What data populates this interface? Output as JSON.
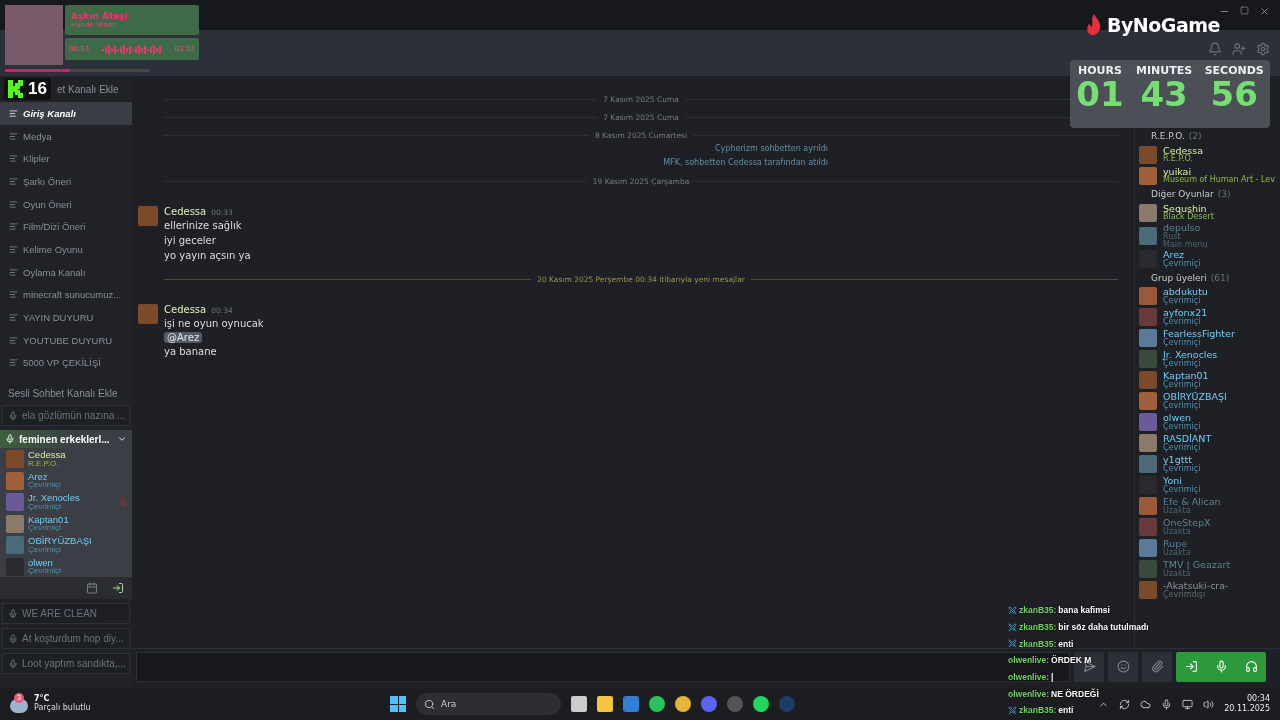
{
  "now_playing": {
    "title": "Aşkın Ateşi",
    "artist": "Hande Yener",
    "elapsed": "00:53",
    "total": "03:52",
    "level": 0.45
  },
  "kick_badge": {
    "count": "16"
  },
  "logo": {
    "text": "ByNoGame"
  },
  "timer": {
    "units": [
      {
        "label": "HOURS",
        "value": "01"
      },
      {
        "label": "MINUTES",
        "value": "43"
      },
      {
        "label": "SECONDS",
        "value": "56"
      }
    ]
  },
  "sidebar": {
    "add_text_channel": "et Kanalı Ekle",
    "text_channels": [
      {
        "name": "Giriş Kanalı",
        "selected": true
      },
      {
        "name": "Medya",
        "selected": false
      },
      {
        "name": "Klipler",
        "selected": false
      },
      {
        "name": "Şarkı Öneri",
        "selected": false
      },
      {
        "name": "Oyun Öneri",
        "selected": false
      },
      {
        "name": "Film/Dizi Öneri",
        "selected": false
      },
      {
        "name": "Kelime Oyunu",
        "selected": false
      },
      {
        "name": "Oylama Kanalı",
        "selected": false
      },
      {
        "name": "minecraft sunucumuz...",
        "selected": false
      },
      {
        "name": "YAYIN DUYURU",
        "selected": false
      },
      {
        "name": "YOUTUBE DUYURU",
        "selected": false
      },
      {
        "name": "5000 VP ÇEKİLİŞİ",
        "selected": false
      }
    ],
    "add_voice_channel": "Sesli Sohbet Kanalı Ekle",
    "voice_channels": [
      {
        "name": "ela gözlümün nazına ...",
        "expanded": false
      },
      {
        "name": "feminen erkeklerl...",
        "expanded": true,
        "members": [
          {
            "name": "Cedessa",
            "status": "R.E.P.O.",
            "kind": "ingame",
            "muted": false
          },
          {
            "name": "Arez",
            "status": "Çevrimiçi",
            "kind": "online",
            "muted": false
          },
          {
            "name": "Jr. Xenocles",
            "status": "Çevrimiçi",
            "kind": "online",
            "muted": true
          },
          {
            "name": "Kaptan01",
            "status": "Çevrimiçi",
            "kind": "online",
            "muted": false
          },
          {
            "name": "OBİRYÜZBAŞI",
            "status": "Çevrimiçi",
            "kind": "online",
            "muted": false
          },
          {
            "name": "olwen",
            "status": "Çevrimiçi",
            "kind": "online",
            "muted": false
          }
        ]
      },
      {
        "name": "WE ARE CLEAN",
        "expanded": false
      },
      {
        "name": "At koşturdum hop diy...",
        "expanded": false
      },
      {
        "name": "Loot yaptım sandıkta,...",
        "expanded": false
      }
    ]
  },
  "chat": {
    "entries": [
      {
        "kind": "date",
        "text": "7 Kasım 2025 Cuma"
      },
      {
        "kind": "date",
        "text": "7 Kasım 2025 Cuma"
      },
      {
        "kind": "date",
        "text": "8 Kasım 2025 Cumartesi"
      },
      {
        "kind": "system",
        "text": "Cypherizm sohbetten ayrıldı"
      },
      {
        "kind": "system",
        "text": "MFK, sohbetten Cedessa tarafından atıldı"
      },
      {
        "kind": "date",
        "text": "19 Kasım 2025 Çarşamba"
      },
      {
        "kind": "message",
        "author": "Cedessa",
        "time": "00:33",
        "lines": [
          {
            "kind": "text",
            "text": "ellerinize sağlık"
          },
          {
            "kind": "text",
            "text": "iyi geceler"
          },
          {
            "kind": "text",
            "text": "yo yayın açsın ya"
          }
        ]
      },
      {
        "kind": "new",
        "text": "20 Kasım 2025 Perşembe 00:34 itibarıyla yeni mesajlar"
      },
      {
        "kind": "message",
        "author": "Cedessa",
        "time": "00:34",
        "lines": [
          {
            "kind": "text",
            "text": "işi ne oyun oynucak"
          },
          {
            "kind": "mention",
            "text": "@Arez"
          },
          {
            "kind": "text",
            "text": "ya banane"
          }
        ]
      }
    ]
  },
  "members": {
    "groups": [
      {
        "title": "R.E.P.O.",
        "count": "(2)",
        "members": [
          {
            "name": "Cedessa",
            "status": "R.E.P.O.",
            "kind": "ingame"
          },
          {
            "name": "yuikai",
            "status": "Museum of Human Art - Lev",
            "kind": "ingame"
          }
        ]
      },
      {
        "title": "Diğer Oyunlar",
        "count": "(3)",
        "members": [
          {
            "name": "Sequshin",
            "status": "Black Desert",
            "kind": "ingame"
          },
          {
            "name": "depulso",
            "status": "Rust",
            "kind": "away",
            "detail": "Main menu"
          },
          {
            "name": "Arez",
            "status": "Çevrimiçi",
            "kind": "online"
          }
        ]
      },
      {
        "title": "Grup üyeleri",
        "count": "(61)",
        "members": [
          {
            "name": "abdukutu",
            "status": "Çevrimiçi",
            "kind": "online"
          },
          {
            "name": "ayfonx21",
            "status": "Çevrimiçi",
            "kind": "online"
          },
          {
            "name": "FearlessFighter",
            "status": "Çevrimiçi",
            "kind": "online"
          },
          {
            "name": "Jr. Xenocles",
            "status": "Çevrimiçi",
            "kind": "online"
          },
          {
            "name": "Kaptan01",
            "status": "Çevrimiçi",
            "kind": "online"
          },
          {
            "name": "OBİRYÜZBAŞI",
            "status": "Çevrimiçi",
            "kind": "online"
          },
          {
            "name": "olwen",
            "status": "Çevrimiçi",
            "kind": "online"
          },
          {
            "name": "RASDİANT",
            "status": "Çevrimiçi",
            "kind": "online"
          },
          {
            "name": "y1gttt",
            "status": "Çevrimiçi",
            "kind": "online"
          },
          {
            "name": "Yoni",
            "status": "Çevrimiçi",
            "kind": "online"
          },
          {
            "name": "Efe & Alican",
            "status": "Uzakta",
            "kind": "away"
          },
          {
            "name": "OneStepX",
            "status": "Uzakta",
            "kind": "away"
          },
          {
            "name": "Rupe",
            "status": "Uzakta",
            "kind": "away"
          },
          {
            "name": "TMV | Geazart",
            "status": "Uzakta",
            "kind": "away"
          },
          {
            "name": "-Akatsuki-cra-",
            "status": "Çevrimdışı",
            "kind": "offline"
          }
        ]
      }
    ]
  },
  "overlay_chat": [
    {
      "user": "zkanB35:",
      "text": "bana kafimsi",
      "kind": "sword"
    },
    {
      "user": "zkanB35:",
      "text": "bir söz daha tutulmadı",
      "kind": "sword"
    },
    {
      "user": "zkanB35:",
      "text": "enti",
      "kind": "sword"
    },
    {
      "user": "olwenlive:",
      "text": "ÖRDEK M",
      "kind": "plain"
    },
    {
      "user": "olwenlive:",
      "text": "|",
      "kind": "plain"
    },
    {
      "user": "olwenlive:",
      "text": "NE ÖRDEĞİ",
      "kind": "plain"
    },
    {
      "user": "zkanB35:",
      "text": "enti",
      "kind": "sword"
    }
  ],
  "taskbar": {
    "weather": {
      "temp": "7°C",
      "desc": "Parçalı bulutlu",
      "badge": "3"
    },
    "search_placeholder": "Ara",
    "time": "00:34",
    "date": "20.11.2025"
  }
}
